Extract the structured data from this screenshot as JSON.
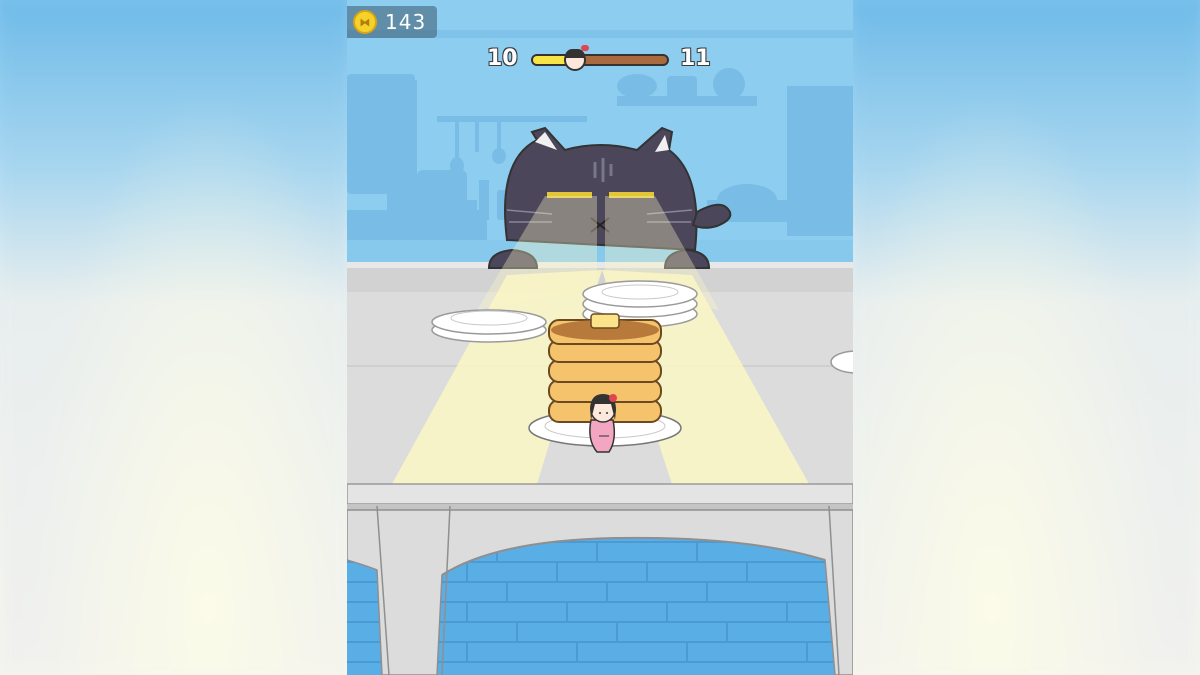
{
  "hud": {
    "coins": "143",
    "coin_icon": "coin-icon",
    "level_current": "10",
    "level_next": "11",
    "level_progress": 0.32
  },
  "colors": {
    "wall": "#8ccdf0",
    "table": "#dcdcdc",
    "cat": "#4b4659",
    "light": "#fbf7c6",
    "pancake": "#f5c36b",
    "progress_fill": "#f7e447",
    "progress_track": "#a86a3e"
  },
  "scene": {
    "cat": "watching-cat",
    "girl": "hiding-girl",
    "pancakes": 5
  }
}
